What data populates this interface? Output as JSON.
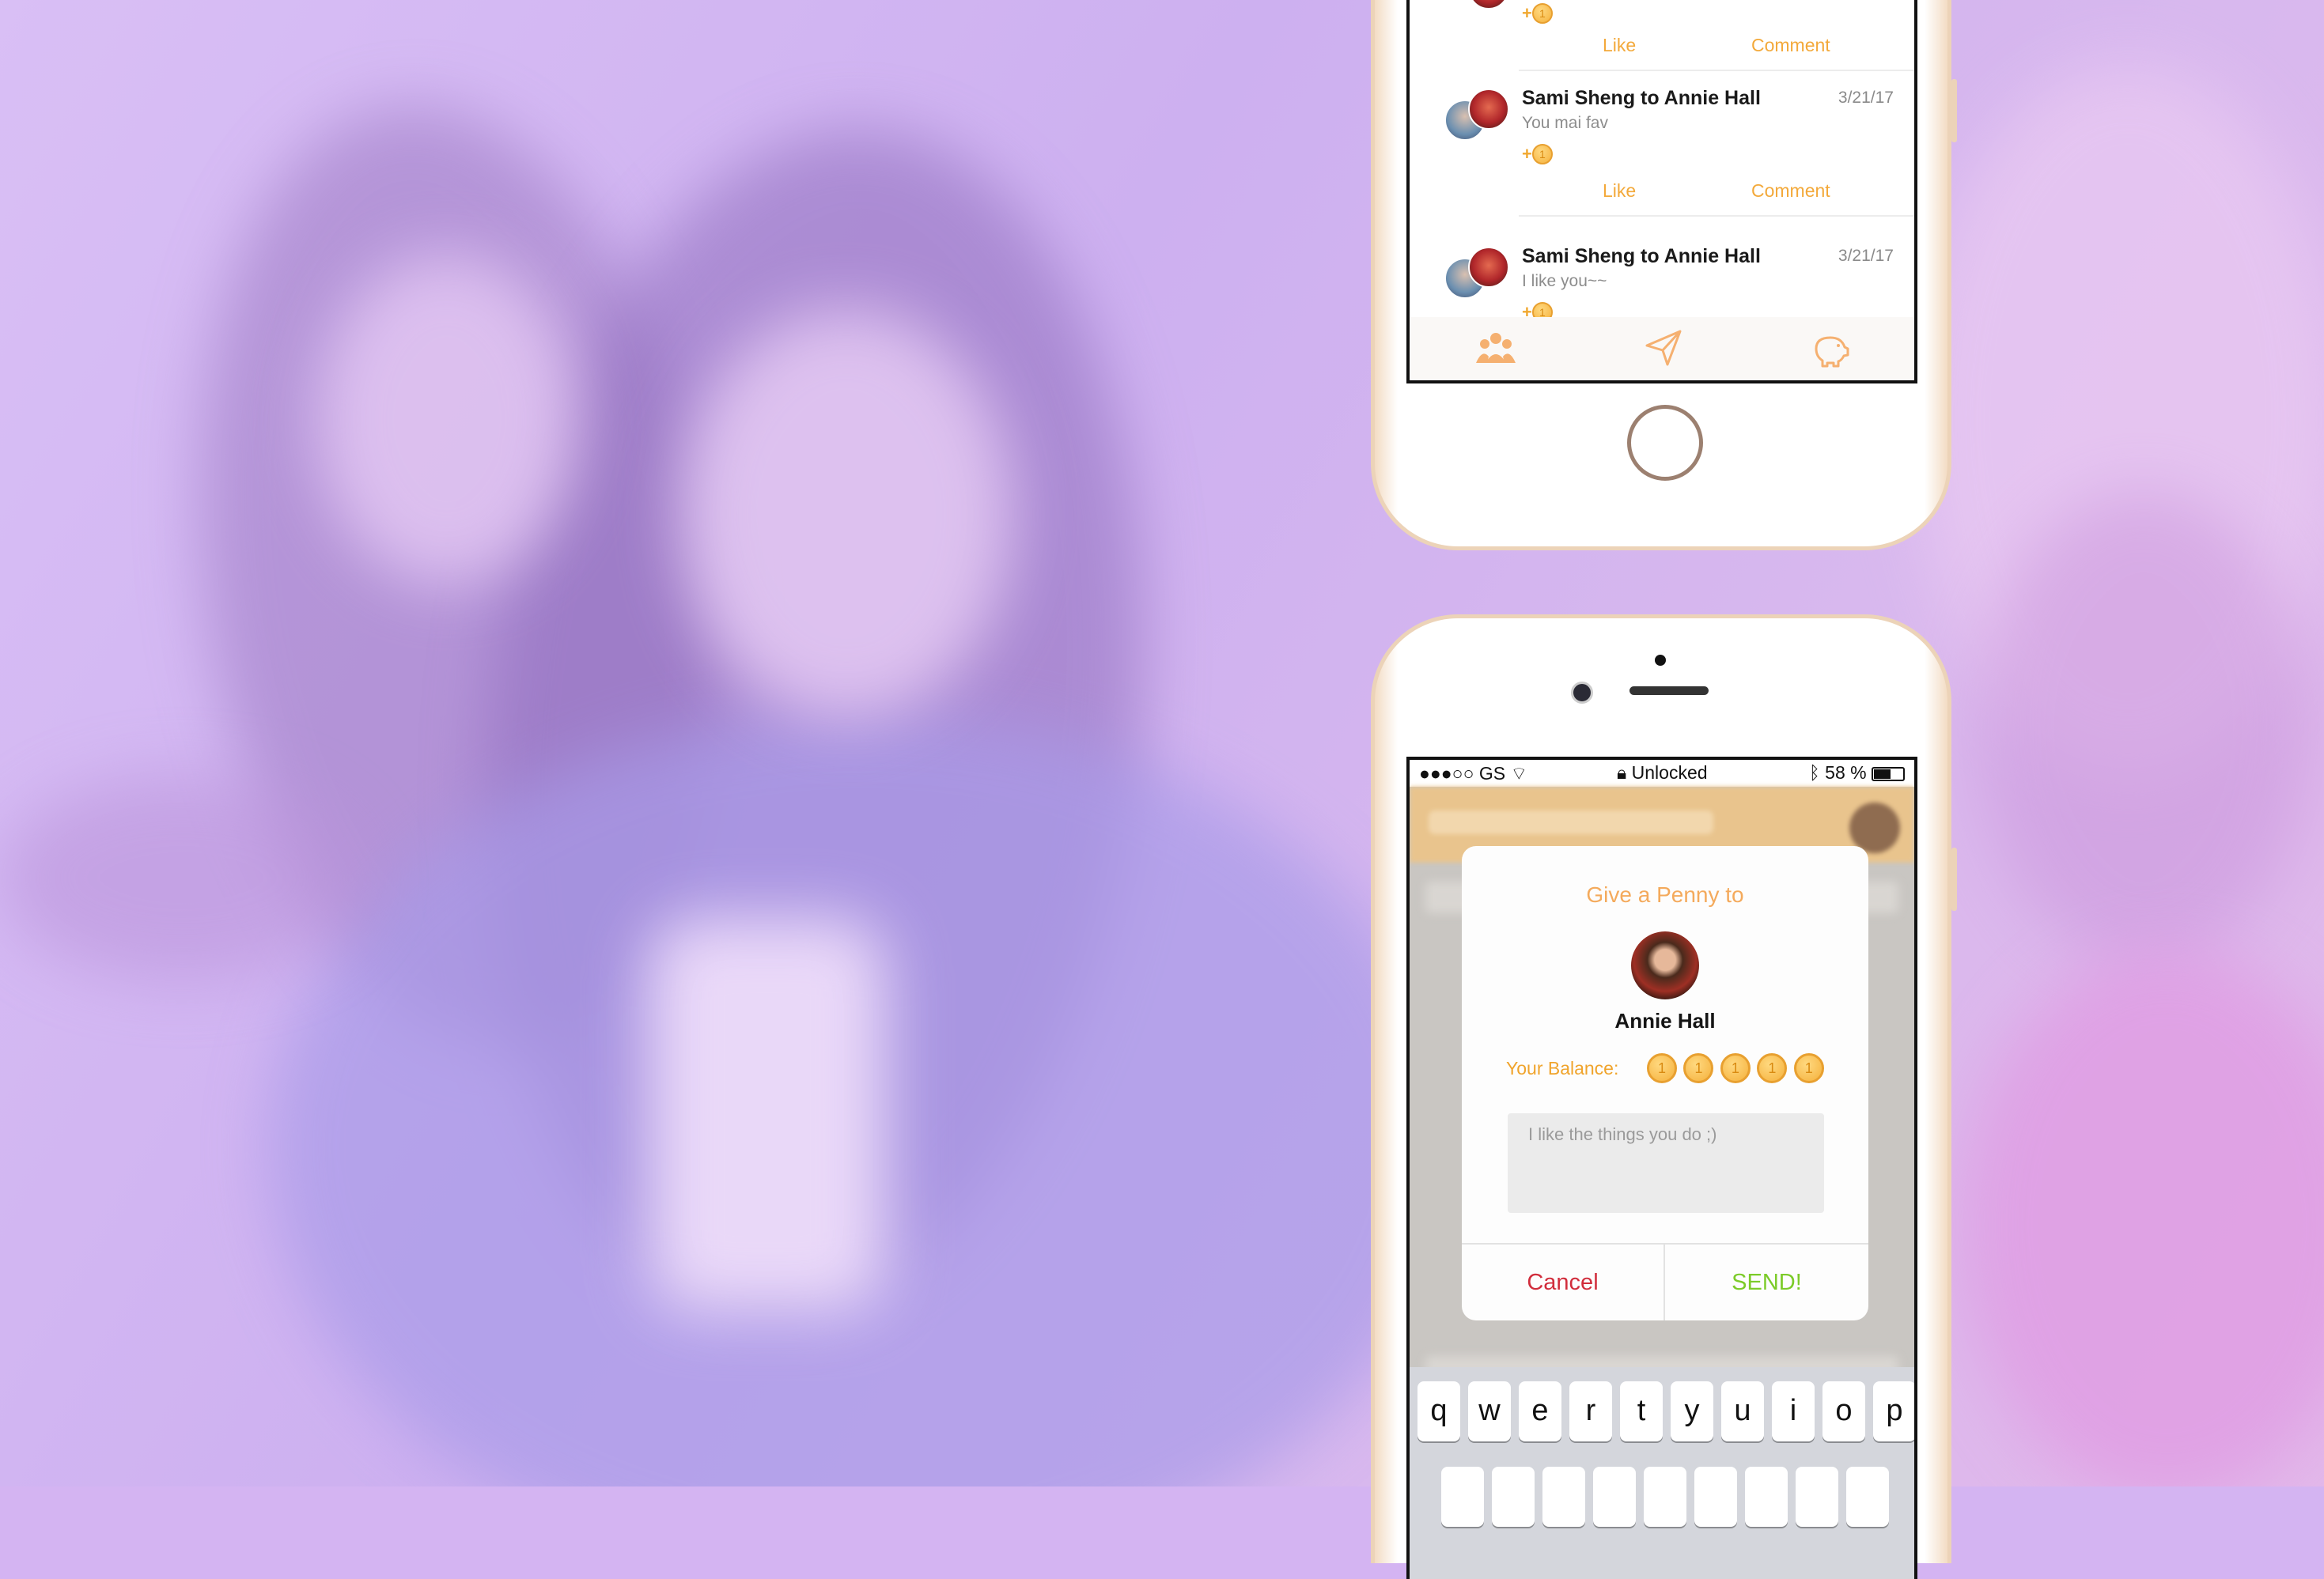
{
  "feed": {
    "like_label": "Like",
    "comment_label": "Comment",
    "coin_plus": "+",
    "coin_glyph": "1",
    "entries": [
      {
        "title": "Sami Sheng to Annie Hall",
        "date": "3/21/17",
        "message": "You mai fav"
      },
      {
        "title": "Sami Sheng to Annie Hall",
        "date": "3/21/17",
        "message": "I like you~~"
      }
    ],
    "tabs": [
      "people-icon",
      "send-icon",
      "piggy-bank-icon"
    ]
  },
  "status_bar": {
    "carrier": "●●●○○ GS",
    "lock_text": "Unlocked",
    "battery": "58 %"
  },
  "dialog": {
    "title": "Give a Penny to",
    "recipient": "Annie Hall",
    "balance_label": "Your Balance:",
    "balance_coins": 5,
    "coin_glyph": "1",
    "message_placeholder": "I like the things you do ;)",
    "cancel_label": "Cancel",
    "send_label": "SEND!"
  },
  "keyboard": {
    "row1": [
      "q",
      "w",
      "e",
      "r",
      "t",
      "y",
      "u",
      "i",
      "o",
      "p"
    ]
  },
  "colors": {
    "accent": "#f3a93a",
    "send": "#7ccb29",
    "cancel": "#d12d3c",
    "background": "#d4b4f2"
  }
}
